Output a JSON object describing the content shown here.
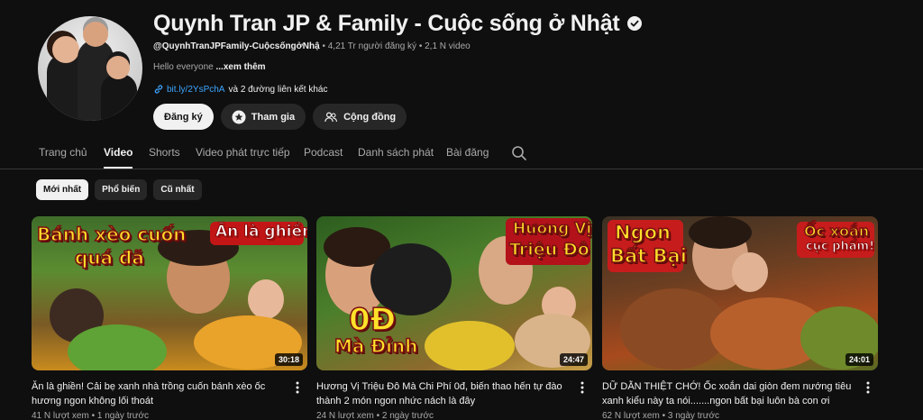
{
  "channel": {
    "title": "Quynh Tran JP & Family - Cuộc sống ở Nhật",
    "handle": "@QuynhTranJPFamily-CuộcsốngởNhậ",
    "subscribers": "4,21 Tr người đăng ký",
    "video_count": "2,1 N video",
    "description": "Hello everyone",
    "more_label": "...xem thêm",
    "link_url": "bit.ly/2YsPchA",
    "link_extra": "và 2 đường liên kết khác",
    "subscribe_label": "Đăng ký",
    "join_label": "Tham gia",
    "community_label": "Cộng đồng"
  },
  "tabs": [
    {
      "label": "Trang chủ"
    },
    {
      "label": "Video"
    },
    {
      "label": "Shorts"
    },
    {
      "label": "Video phát trực tiếp"
    },
    {
      "label": "Podcast"
    },
    {
      "label": "Danh sách phát"
    },
    {
      "label": "Bài đăng"
    }
  ],
  "active_tab": "Video",
  "chips": [
    {
      "label": "Mới nhất"
    },
    {
      "label": "Phổ biến"
    },
    {
      "label": "Cũ nhất"
    }
  ],
  "videos": [
    {
      "title": "Ăn là ghiền! Cải bẹ xanh nhà trồng cuốn bánh xèo ốc hương ngon không lối thoát",
      "views": "41 N",
      "age": "1 ngày trước",
      "duration": "30:18",
      "captions": [
        "Bánh xèo cuốn",
        "quá đã",
        "Ăn là ghiền!"
      ]
    },
    {
      "title": "Hương Vị Triệu Đô Mà Chi Phí 0đ, biến thao hến tự đào thành 2 món ngon nhức nách là đây",
      "views": "24 N",
      "age": "2 ngày trước",
      "duration": "24:47",
      "captions": [
        "Hương Vị",
        "Triệu Đô",
        "0Đ",
        "Mà Đỉnh"
      ]
    },
    {
      "title": "DỮ DẰN THIỆT CHỚ! Ốc xoắn dai giòn đem nướng tiêu xanh kiểu này ta nói.......ngon bất bại luôn bà con ơi",
      "views": "62 N",
      "age": "3 ngày trước",
      "duration": "24:01",
      "captions": [
        "Ngon",
        "Bất Bại",
        "Ốc xoắn",
        "cực phẩm!"
      ]
    }
  ],
  "colors": {
    "background": "#0f0f0f",
    "link": "#3ea6ff",
    "chip_active": "#f1f1f1",
    "chip": "#272727"
  }
}
